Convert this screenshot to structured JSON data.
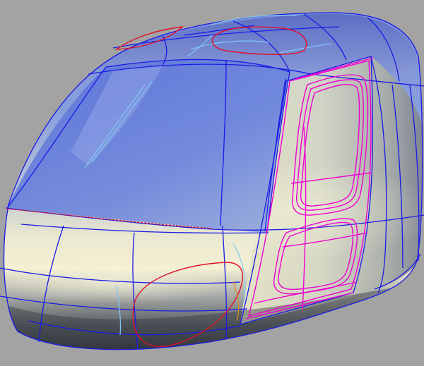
{
  "viewport": {
    "background": "#a3a3a3",
    "model": "helicopter-cabin-surface",
    "render_mode": "shaded-with-wireframe"
  },
  "colors": {
    "surface_highlight": "#f6f2d6",
    "surface_blue": "#6f87d8",
    "surface_dark": "#3c4048",
    "isoparm_curves": "#1a1ae6",
    "trim_curves_magenta": "#f000d0",
    "trim_curves_red": "#e0102a",
    "guide_curves_light": "#7fc8f0",
    "accent_orange": "#e08a20"
  }
}
